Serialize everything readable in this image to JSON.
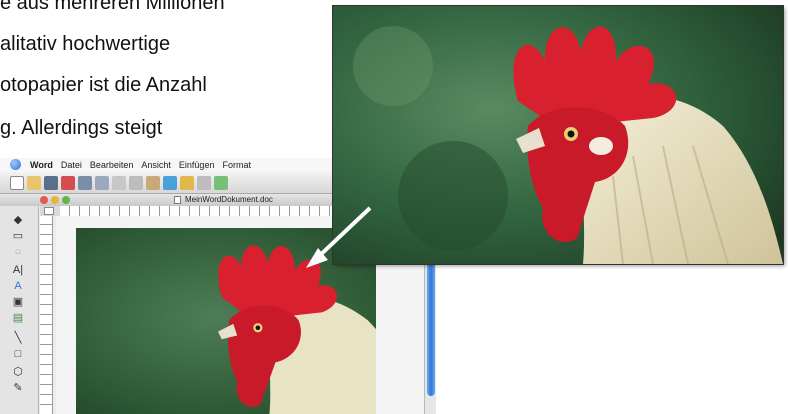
{
  "document": {
    "lines": [
      "e aus mehreren Millionen",
      "alitativ hochwertige",
      "otopapier ist die Anzahl",
      "g. Allerdings steigt"
    ]
  },
  "word": {
    "menu": [
      "Word",
      "Datei",
      "Bearbeiten",
      "Ansicht",
      "Einfügen",
      "Format"
    ],
    "window_title": "MeinWordDokument.doc"
  },
  "icons": [
    "apple-icon",
    "new-doc-icon",
    "open-icon",
    "save-icon",
    "print-icon",
    "preview-icon",
    "zoom-icon",
    "cut-icon",
    "copy-icon",
    "paste-icon",
    "format-painter-icon",
    "undo-icon",
    "redo-icon",
    "arrow-icon"
  ],
  "colors": {
    "accent": "#2e78d6",
    "arrow": "#ffffff",
    "comb": "#d8202f"
  }
}
